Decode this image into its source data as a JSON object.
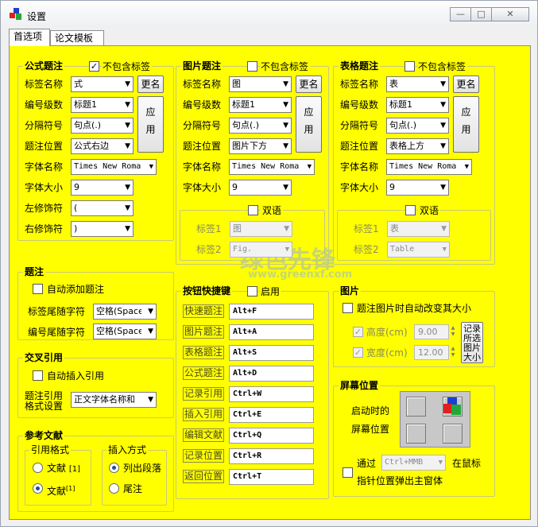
{
  "window": {
    "title": "设置",
    "icon": "colored-cubes-icon"
  },
  "tabs": [
    {
      "label": "首选项",
      "active": true
    },
    {
      "label": "论文模板",
      "active": false
    }
  ],
  "formula": {
    "title": "公式题注",
    "no_label_check": "不包含标签",
    "no_label_checked": true,
    "rows": [
      {
        "label": "标签名称",
        "value": "式"
      },
      {
        "label": "编号级数",
        "value": "标题1"
      },
      {
        "label": "分隔符号",
        "value": "句点(.)"
      },
      {
        "label": "题注位置",
        "value": "公式右边"
      },
      {
        "label": "字体名称",
        "value": "Times New Roma"
      },
      {
        "label": "字体大小",
        "value": "9"
      },
      {
        "label": "左修饰符",
        "value": "("
      },
      {
        "label": "右修饰符",
        "value": ")"
      }
    ],
    "rename_button": "更名",
    "apply_button": [
      "应",
      "用"
    ]
  },
  "picture": {
    "title": "图片题注",
    "no_label_check": "不包含标签",
    "rows": [
      {
        "label": "标签名称",
        "value": "图"
      },
      {
        "label": "编号级数",
        "value": "标题1"
      },
      {
        "label": "分隔符号",
        "value": "句点(.)"
      },
      {
        "label": "题注位置",
        "value": "图片下方"
      },
      {
        "label": "字体名称",
        "value": "Times New Roma"
      },
      {
        "label": "字体大小",
        "value": "9"
      }
    ],
    "rename_button": "更名",
    "apply_button": [
      "应",
      "用"
    ],
    "bilingual": {
      "check": "双语",
      "label1": "标签1",
      "value1": "图",
      "label2": "标签2",
      "value2": "Fig."
    }
  },
  "table": {
    "title": "表格题注",
    "no_label_check": "不包含标签",
    "rows": [
      {
        "label": "标签名称",
        "value": "表"
      },
      {
        "label": "编号级数",
        "value": "标题1"
      },
      {
        "label": "分隔符号",
        "value": "句点(.)"
      },
      {
        "label": "题注位置",
        "value": "表格上方"
      },
      {
        "label": "字体名称",
        "value": "Times New Roma"
      },
      {
        "label": "字体大小",
        "value": "9"
      }
    ],
    "rename_button": "更名",
    "apply_button": [
      "应",
      "用"
    ],
    "bilingual": {
      "check": "双语",
      "label1": "标签1",
      "value1": "表",
      "label2": "标签2",
      "value2": "Table"
    }
  },
  "caption": {
    "title": "题注",
    "auto_add": "自动添加题注",
    "label_tail": "标签尾随字符",
    "label_tail_value": "空格(Space",
    "num_tail": "编号尾随字符",
    "num_tail_value": "空格(Space"
  },
  "crossref": {
    "title": "交叉引用",
    "auto_insert": "自动插入引用",
    "format_label_1": "题注引用",
    "format_label_2": "格式设置",
    "format_value": "正文字体名称和"
  },
  "reference": {
    "title": "参考文献",
    "cite_format": {
      "title": "引用格式",
      "option1": "文献",
      "option1_sup": "[1]",
      "option2": "文献",
      "option2_sup": "[1]"
    },
    "insert_mode": {
      "title": "插入方式",
      "option1": "列出段落",
      "option2": "尾注"
    }
  },
  "hotkeys": {
    "title": "按钮快捷键",
    "enable": "启用",
    "items": [
      {
        "label": "快速题注",
        "key": "Alt+F"
      },
      {
        "label": "图片题注",
        "key": "Alt+A"
      },
      {
        "label": "表格题注",
        "key": "Alt+S"
      },
      {
        "label": "公式题注",
        "key": "Alt+D"
      },
      {
        "label": "记录引用",
        "key": "Ctrl+W"
      },
      {
        "label": "插入引用",
        "key": "Ctrl+E"
      },
      {
        "label": "编辑文献",
        "key": "Ctrl+Q"
      },
      {
        "label": "记录位置",
        "key": "Ctrl+R"
      },
      {
        "label": "返回位置",
        "key": "Ctrl+T"
      }
    ]
  },
  "image": {
    "title": "图片",
    "auto_resize": "题注图片时自动改变其大小",
    "height_label": "高度(cm)",
    "height_value": "9.00",
    "width_label": "宽度(cm)",
    "width_value": "12.00",
    "record_button": [
      "记录",
      "所选",
      "图片",
      "大小"
    ]
  },
  "screen": {
    "title": "屏幕位置",
    "startup_1": "启动时的",
    "startup_2": "屏幕位置",
    "via": "通过",
    "hotkey": "Ctrl+MMB",
    "at_mouse": "在鼠标",
    "popup": "指针位置弹出主窗体"
  },
  "watermark": {
    "text": "绿色先锋",
    "url": "www.greenxf.com"
  }
}
